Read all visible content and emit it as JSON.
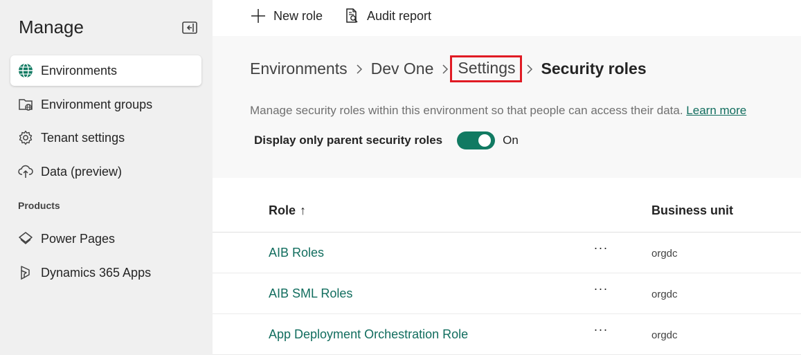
{
  "sidebar": {
    "title": "Manage",
    "items": [
      {
        "label": "Environments",
        "icon": "globe-icon",
        "active": true
      },
      {
        "label": "Environment groups",
        "icon": "environment-groups-icon"
      },
      {
        "label": "Tenant settings",
        "icon": "gear-icon"
      },
      {
        "label": "Data (preview)",
        "icon": "cloud-upload-icon"
      }
    ],
    "section_label": "Products",
    "products": [
      {
        "label": "Power Pages",
        "icon": "power-pages-icon"
      },
      {
        "label": "Dynamics 365 Apps",
        "icon": "dynamics-icon"
      }
    ]
  },
  "toolbar": {
    "new_role": "New role",
    "audit_report": "Audit report"
  },
  "breadcrumb": {
    "items": [
      "Environments",
      "Dev One",
      "Settings",
      "Security roles"
    ]
  },
  "description": {
    "text": "Manage security roles within this environment so that people can access their data.",
    "link": "Learn more"
  },
  "toggle": {
    "label": "Display only parent security roles",
    "state": "On",
    "on": true
  },
  "table": {
    "columns": [
      "Role",
      "Business unit"
    ],
    "sort_indicator": "↑",
    "rows": [
      {
        "role": "AIB Roles",
        "more": "···",
        "business_unit": "orgdc"
      },
      {
        "role": "AIB SML Roles",
        "more": "···",
        "business_unit": "orgdc"
      },
      {
        "role": "App Deployment Orchestration Role",
        "more": "···",
        "business_unit": "orgdc"
      }
    ]
  },
  "colors": {
    "accent": "#117a62",
    "link": "#116d5e",
    "highlight_box": "#e01b24"
  }
}
